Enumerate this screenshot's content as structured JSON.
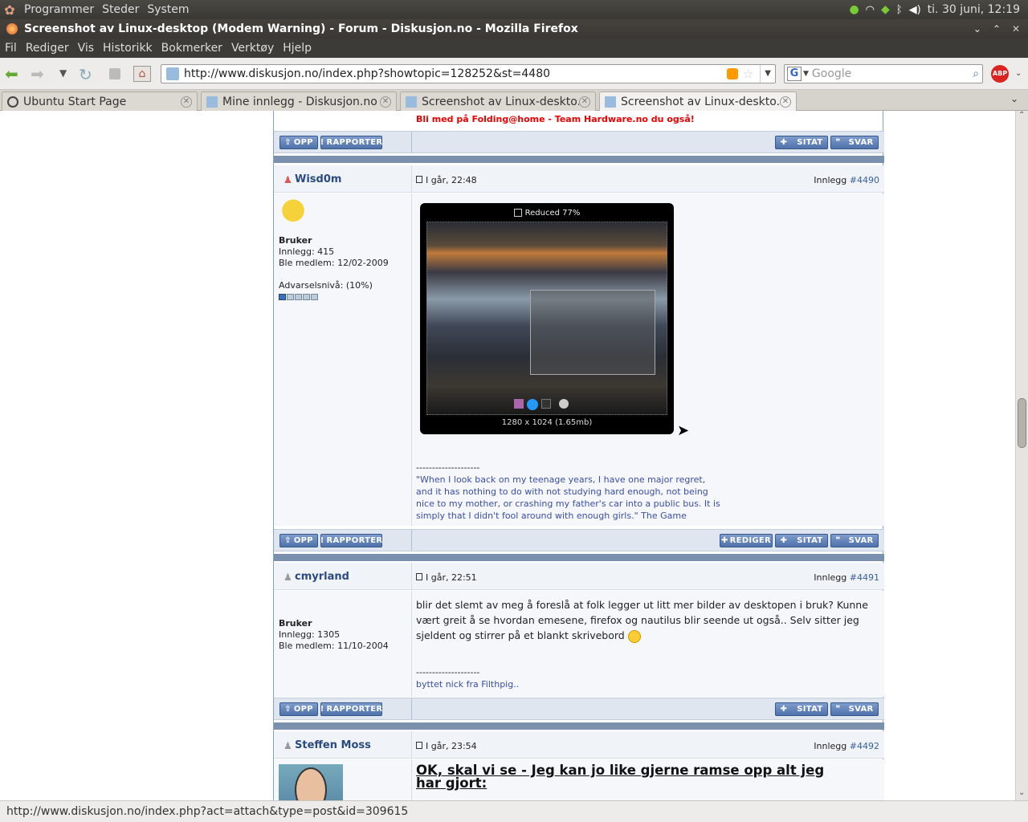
{
  "gnome_panel": {
    "menus": [
      "Programmer",
      "Steder",
      "System"
    ],
    "clock": "ti. 30 juni, 12:19"
  },
  "window": {
    "title": "Screenshot av Linux-desktop (Modem Warning) - Forum - Diskusjon.no - Mozilla Firefox"
  },
  "menubar": [
    "Fil",
    "Rediger",
    "Vis",
    "Historikk",
    "Bokmerker",
    "Verktøy",
    "Hjelp"
  ],
  "navbar": {
    "url": "http://www.diskusjon.no/index.php?showtopic=128252&st=4480",
    "search_placeholder": "Google"
  },
  "tabs": [
    {
      "label": "Ubuntu Start Page"
    },
    {
      "label": "Mine innlegg - Diskusjon.no"
    },
    {
      "label": "Screenshot av Linux-deskto..."
    },
    {
      "label": "Screenshot av Linux-deskto..."
    }
  ],
  "forum": {
    "top_sig": "Bli med på Folding@home - Team Hardware.no du også!",
    "buttons": {
      "opp": "OPP",
      "rapporter": "RAPPORTER",
      "sitat": "SITAT",
      "svar": "SVAR",
      "rediger": "REDIGER"
    },
    "posts": [
      {
        "author": "Wisd0m",
        "date": "I går, 22:48",
        "num_label": "Innlegg",
        "num": "#4490",
        "role": "Bruker",
        "posts_line": "Innlegg: 415",
        "member_line": "Ble medlem: 12/02-2009",
        "warn_line": "Advarselsnivå: (10%)",
        "image_caption": "Reduced 77%",
        "image_size": "1280 x 1024 (1.65mb)",
        "sig_sep": "--------------------",
        "sig": "\"When I look back on my teenage years, I have one major regret, and it has nothing to do with not studying hard enough, not being nice to my mother, or crashing my father's car into a public bus. It is simply that I didn't fool around with enough girls.\" The Game"
      },
      {
        "author": "cmyrland",
        "date": "I går, 22:51",
        "num_label": "Innlegg",
        "num": "#4491",
        "role": "Bruker",
        "posts_line": "Innlegg: 1305",
        "member_line": "Ble medlem: 11/10-2004",
        "text": "blir det slemt av meg å foreslå at folk legger ut litt mer bilder av desktopen i bruk? Kunne vært greit å se hvordan emesene, firefox og nautilus blir seende ut også.. Selv sitter jeg sjeldent og stirrer på et blankt skrivebord",
        "sig_sep": "--------------------",
        "sig": "byttet nick fra Filthpig.."
      },
      {
        "author": "Steffen Moss",
        "date": "I går, 23:54",
        "num_label": "Innlegg",
        "num": "#4492",
        "headline": "OK, skal vi se - Jeg kan jo like gjerne ramse opp alt jeg har gjort:"
      }
    ]
  },
  "statusbar": {
    "text": "http://www.diskusjon.no/index.php?act=attach&type=post&id=309615"
  }
}
